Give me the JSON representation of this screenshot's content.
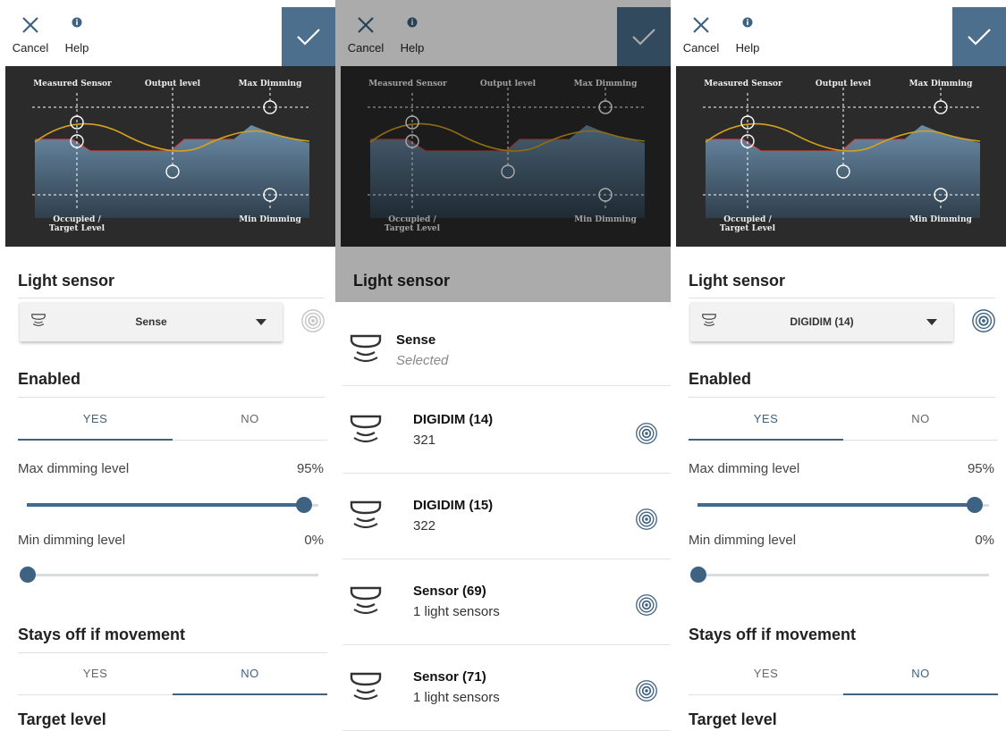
{
  "topbar": {
    "cancel_label": "Cancel",
    "help_label": "Help"
  },
  "diagram": {
    "measured_sensor": "Measured Sensor",
    "output_level": "Output level",
    "max_dimming": "Max Dimming",
    "occupied_line1": "Occupied /",
    "occupied_line2": "Target Level",
    "min_dimming": "Min Dimming"
  },
  "light_sensor_heading": "Light sensor",
  "enabled_heading": "Enabled",
  "stays_off_heading": "Stays off if movement",
  "target_level_heading": "Target level",
  "toggle": {
    "yes": "YES",
    "no": "NO"
  },
  "max_dimming": {
    "label": "Max dimming level",
    "value_text": "95%",
    "value": 95
  },
  "min_dimming": {
    "label": "Min dimming level",
    "value_text": "0%",
    "value": 0
  },
  "panel1": {
    "selected_sensor": "Sense",
    "enabled": "yes",
    "stays_off": "no"
  },
  "panel3": {
    "selected_sensor": "DIGIDIM (14)",
    "enabled": "yes",
    "stays_off": "no"
  },
  "sensor_list": {
    "current": {
      "name": "Sense",
      "status": "Selected"
    },
    "items": [
      {
        "name": "DIGIDIM (14)",
        "sub": "321"
      },
      {
        "name": "DIGIDIM (15)",
        "sub": "322"
      },
      {
        "name": "Sensor (69)",
        "sub": "1 light sensors"
      },
      {
        "name": "Sensor (71)",
        "sub": "1 light sensors"
      }
    ]
  },
  "colors": {
    "accent": "#3d6282",
    "confirm_bg": "#4b6f8d",
    "diagram_bg": "#2b2b2b"
  },
  "icons": {
    "cancel": "close-icon",
    "help": "info-icon",
    "confirm": "check-icon",
    "sensor": "sensor-icon",
    "identify": "target-icon"
  }
}
